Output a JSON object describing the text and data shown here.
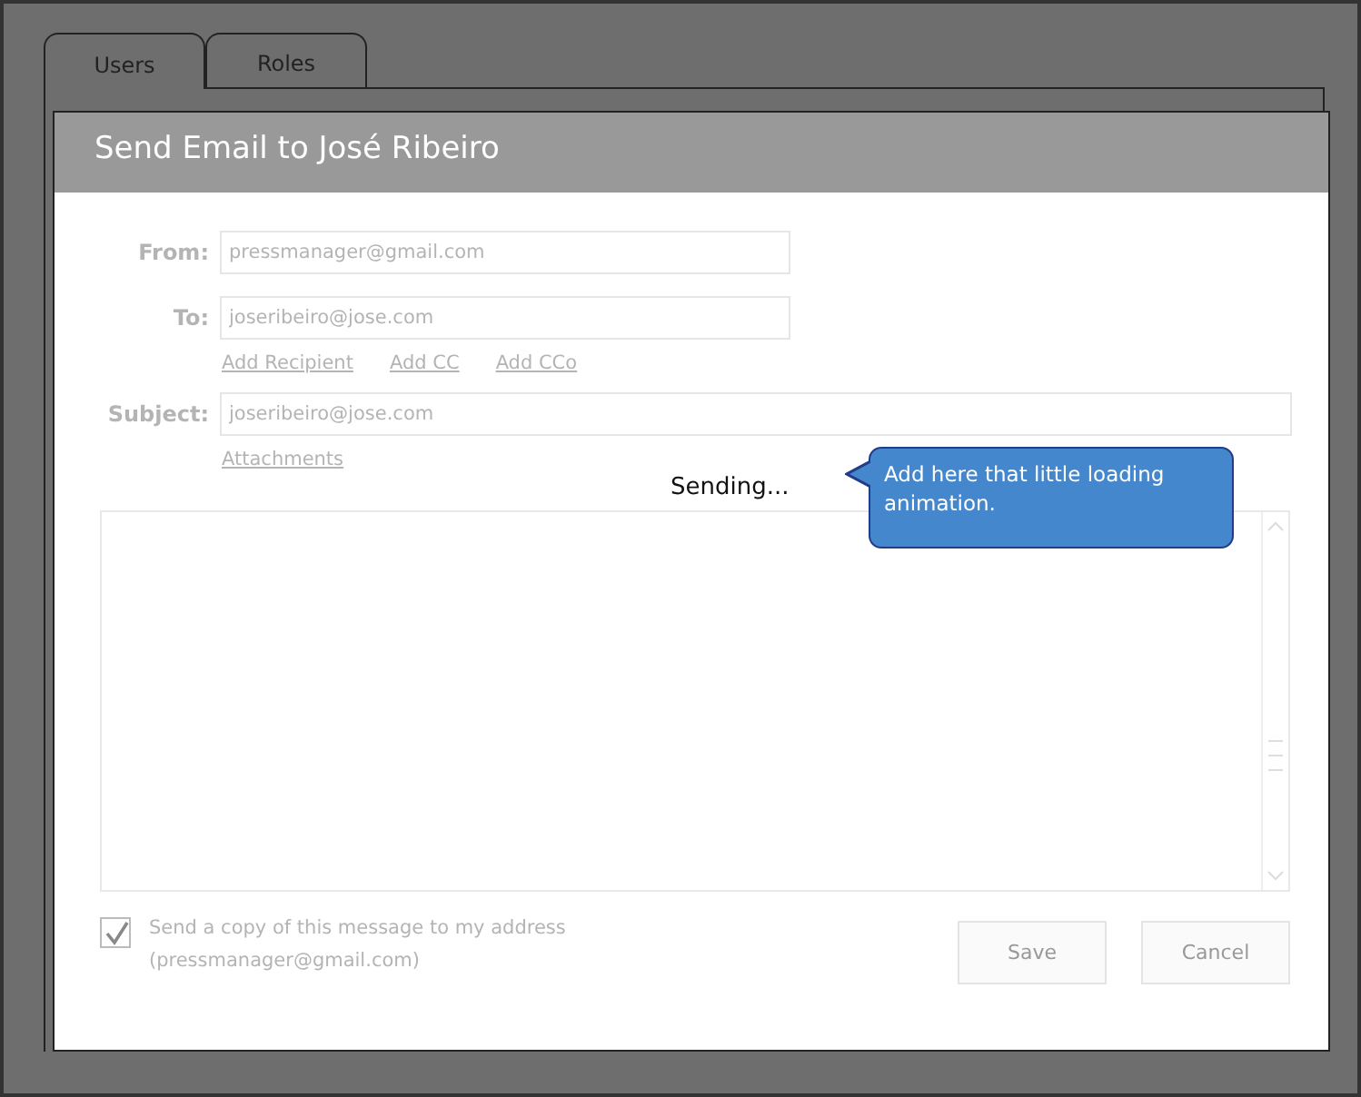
{
  "tabs": [
    {
      "label": "Users",
      "selected": true
    },
    {
      "label": "Roles",
      "selected": false
    }
  ],
  "dialog": {
    "title": "Send Email to José Ribeiro",
    "disabled": true,
    "fields": [
      {
        "label": "From:",
        "value": "pressmanager@gmail.com",
        "wide": false
      },
      {
        "label": "To:",
        "value": "joseribeiro@jose.com",
        "wide": false,
        "links": [
          "Add Recipient",
          "Add CC",
          "Add CCo"
        ]
      },
      {
        "label": "Subject:",
        "value": "joseribeiro@jose.com",
        "wide": true,
        "links": [
          "Attachments"
        ]
      }
    ],
    "status": "Sending...",
    "callout": "Add here that little loading animation.",
    "copy_checkbox": {
      "label": "Send a copy of this message to my address (pressmanager@gmail.com)",
      "checked": true
    },
    "buttons": [
      "Save",
      "Cancel"
    ]
  }
}
